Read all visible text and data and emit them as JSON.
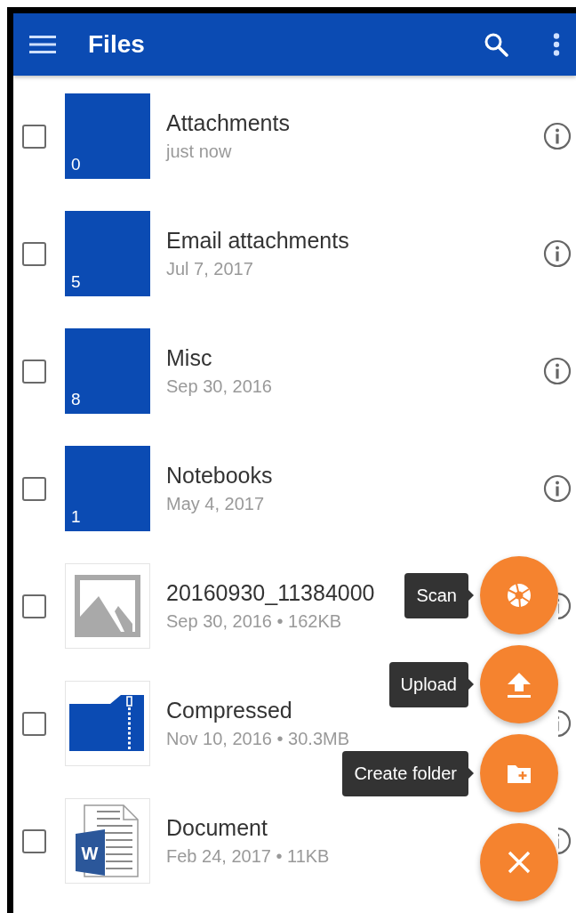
{
  "app_bar": {
    "title": "Files"
  },
  "files": [
    {
      "kind": "folder",
      "name": "Attachments",
      "detail": "just now",
      "count": "0",
      "checked": false
    },
    {
      "kind": "folder",
      "name": "Email attachments",
      "detail": "Jul 7, 2017",
      "count": "5",
      "checked": false
    },
    {
      "kind": "folder",
      "name": "Misc",
      "detail": "Sep 30, 2016",
      "count": "8",
      "checked": false
    },
    {
      "kind": "folder",
      "name": "Notebooks",
      "detail": "May 4, 2017",
      "count": "1",
      "checked": false
    },
    {
      "kind": "image",
      "name": "20160930_11384000",
      "detail": "Sep 30, 2016 • 162KB",
      "checked": false
    },
    {
      "kind": "zip",
      "name": "Compressed",
      "detail": "Nov 10, 2016 • 30.3MB",
      "checked": false
    },
    {
      "kind": "word",
      "badge": "W",
      "name": "Document",
      "detail": "Feb 24, 2017 • 11KB",
      "checked": false
    }
  ],
  "fab_menu": {
    "actions": [
      {
        "kind": "scan",
        "label": "Scan"
      },
      {
        "kind": "upload",
        "label": "Upload"
      },
      {
        "kind": "create_folder",
        "label": "Create folder"
      }
    ]
  }
}
